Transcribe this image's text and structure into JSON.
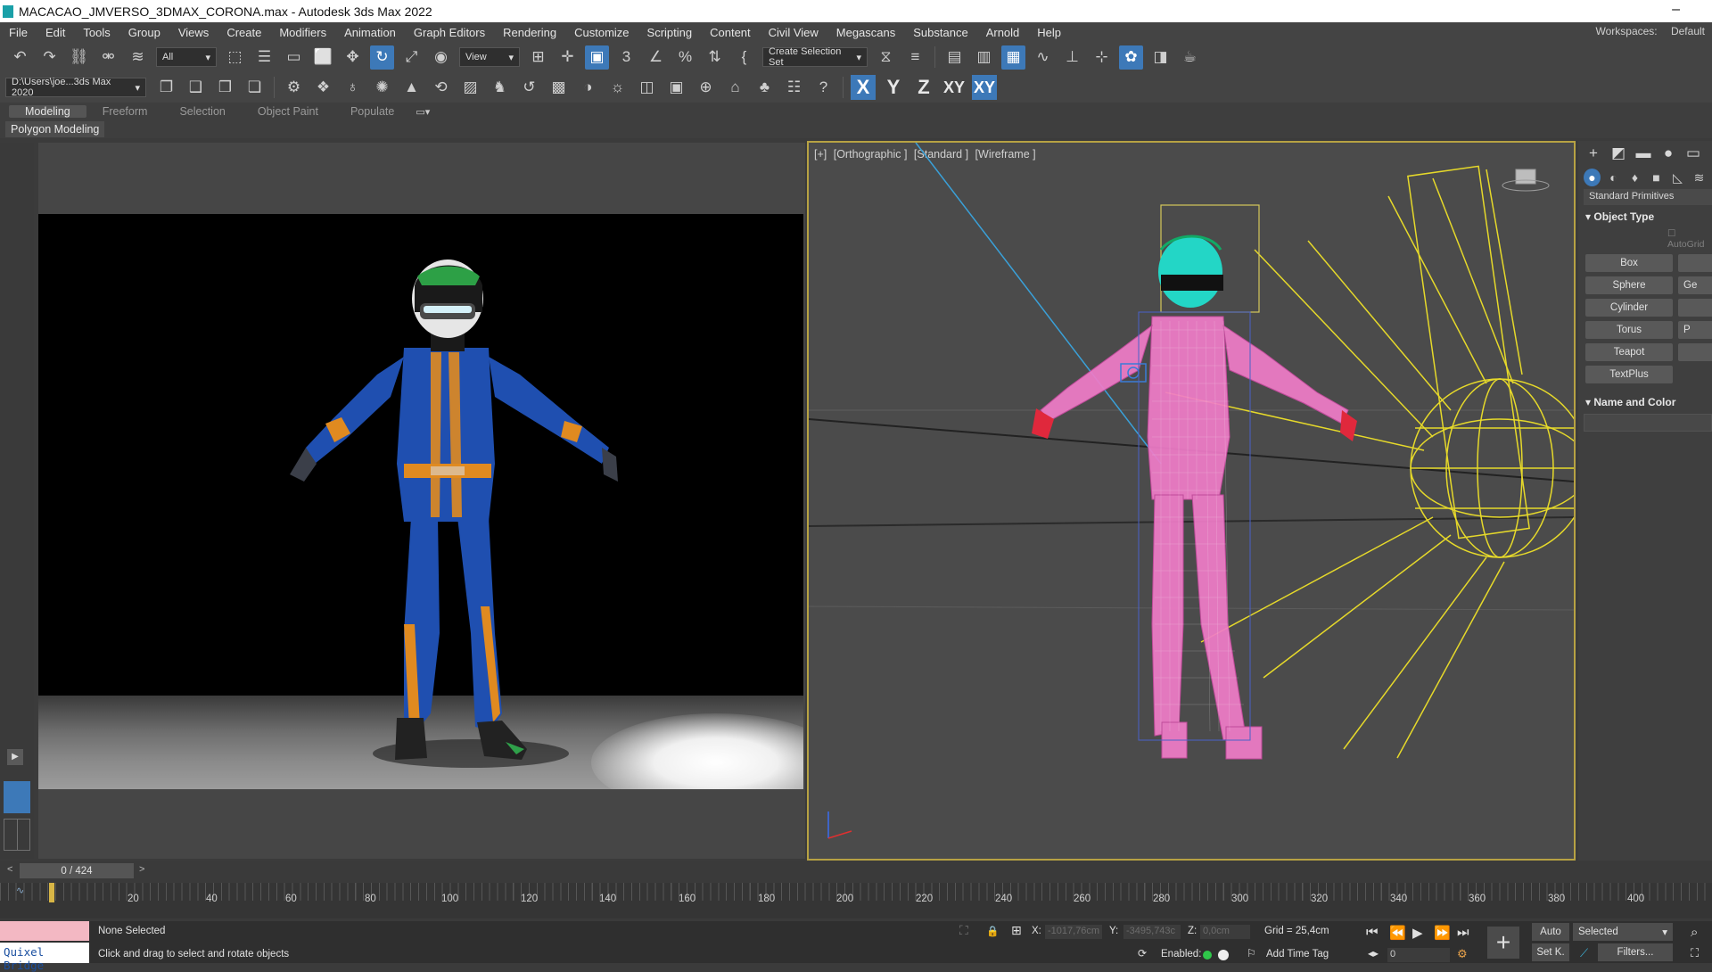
{
  "window": {
    "title": "MACACAO_JMVERSO_3DMAX_CORONA.max - Autodesk 3ds Max 2022",
    "minimize": "–"
  },
  "menu": [
    "File",
    "Edit",
    "Tools",
    "Group",
    "Views",
    "Create",
    "Modifiers",
    "Animation",
    "Graph Editors",
    "Rendering",
    "Customize",
    "Scripting",
    "Content",
    "Civil View",
    "Megascans",
    "Substance",
    "Arnold",
    "Help"
  ],
  "workspaces": {
    "label": "Workspaces:",
    "value": "Default"
  },
  "toolbar": {
    "selection_filter": "All",
    "ref_coord": "View",
    "create_selection_set": "Create Selection Set",
    "project_path": "D:\\Users\\joe...3ds Max 2020",
    "axis_x": "X",
    "axis_y": "Y",
    "axis_z": "Z",
    "axis_xy": "XY",
    "axis_xy_active": "XY"
  },
  "ribbon": {
    "tabs": [
      "Modeling",
      "Freeform",
      "Selection",
      "Object Paint",
      "Populate"
    ],
    "active_tab": "Modeling",
    "sub_label": "Polygon Modeling"
  },
  "viewport_right": {
    "labels": [
      "[+]",
      "[Orthographic ]",
      "[Standard ]",
      "[Wireframe ]"
    ]
  },
  "command_panel": {
    "category": "Standard Primitives",
    "object_type_title": "Object Type",
    "autogrid": "AutoGrid",
    "buttons": [
      {
        "label": "Box",
        "right": ""
      },
      {
        "label": "Sphere",
        "right": "Ge"
      },
      {
        "label": "Cylinder",
        "right": ""
      },
      {
        "label": "Torus",
        "right": "P"
      },
      {
        "label": "Teapot",
        "right": ""
      },
      {
        "label": "TextPlus",
        "right": ""
      }
    ],
    "name_color_title": "Name and Color"
  },
  "timeline": {
    "frame_display": "0 / 424",
    "ticks": [
      "20",
      "40",
      "60",
      "80",
      "100",
      "120",
      "140",
      "160",
      "180",
      "200",
      "220",
      "240",
      "260",
      "280",
      "300",
      "320",
      "340",
      "360",
      "380",
      "400"
    ]
  },
  "status": {
    "quixel": "Quixel Bridge",
    "selection": "None Selected",
    "prompt": "Click and drag to select and rotate objects",
    "x_label": "X:",
    "x_value": "-1017,76cm",
    "y_label": "Y:",
    "y_value": "-3495,743c",
    "z_label": "Z:",
    "z_value": "0,0cm",
    "grid": "Grid = 25,4cm",
    "enabled": "Enabled:",
    "add_time_tag": "Add Time Tag",
    "auto_key": "Auto",
    "key_filter": "Selected",
    "set_key": "Set K.",
    "filters": "Filters...",
    "frame_field": "0"
  },
  "colors": {
    "accent": "#3d79b8",
    "viewport_border": "#b7a243"
  }
}
